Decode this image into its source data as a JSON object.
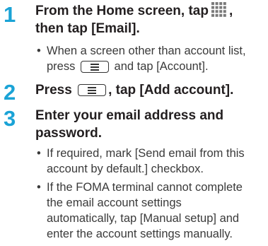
{
  "steps": [
    {
      "number": "1",
      "title_line1_pre": "From the Home screen, tap",
      "title_line1_post": ",",
      "title_line2": "then tap [Email].",
      "icon": "apps-grid-icon",
      "bullets": [
        {
          "line1_pre": "When a screen other than account list,",
          "line2_pre": "press",
          "line2_post": "and tap [Account].",
          "icon": "menu-key-icon"
        }
      ]
    },
    {
      "number": "2",
      "title_pre": "Press",
      "title_post": ", tap [Add account].",
      "icon": "menu-key-icon"
    },
    {
      "number": "3",
      "title_line1": "Enter your email address and",
      "title_line2": "password.",
      "bullets": [
        {
          "lines": [
            "If required, mark [Send email from this",
            "account by default.] checkbox."
          ]
        },
        {
          "lines": [
            "If the FOMA terminal cannot complete",
            "the email account settings",
            "automatically, tap [Manual setup] and",
            "enter the account settings manually."
          ]
        }
      ]
    }
  ],
  "colors": {
    "step_number": "#1aa3d6",
    "text": "#231f20",
    "grid_icon": "#7a7a7a"
  },
  "bullet_char": "•"
}
